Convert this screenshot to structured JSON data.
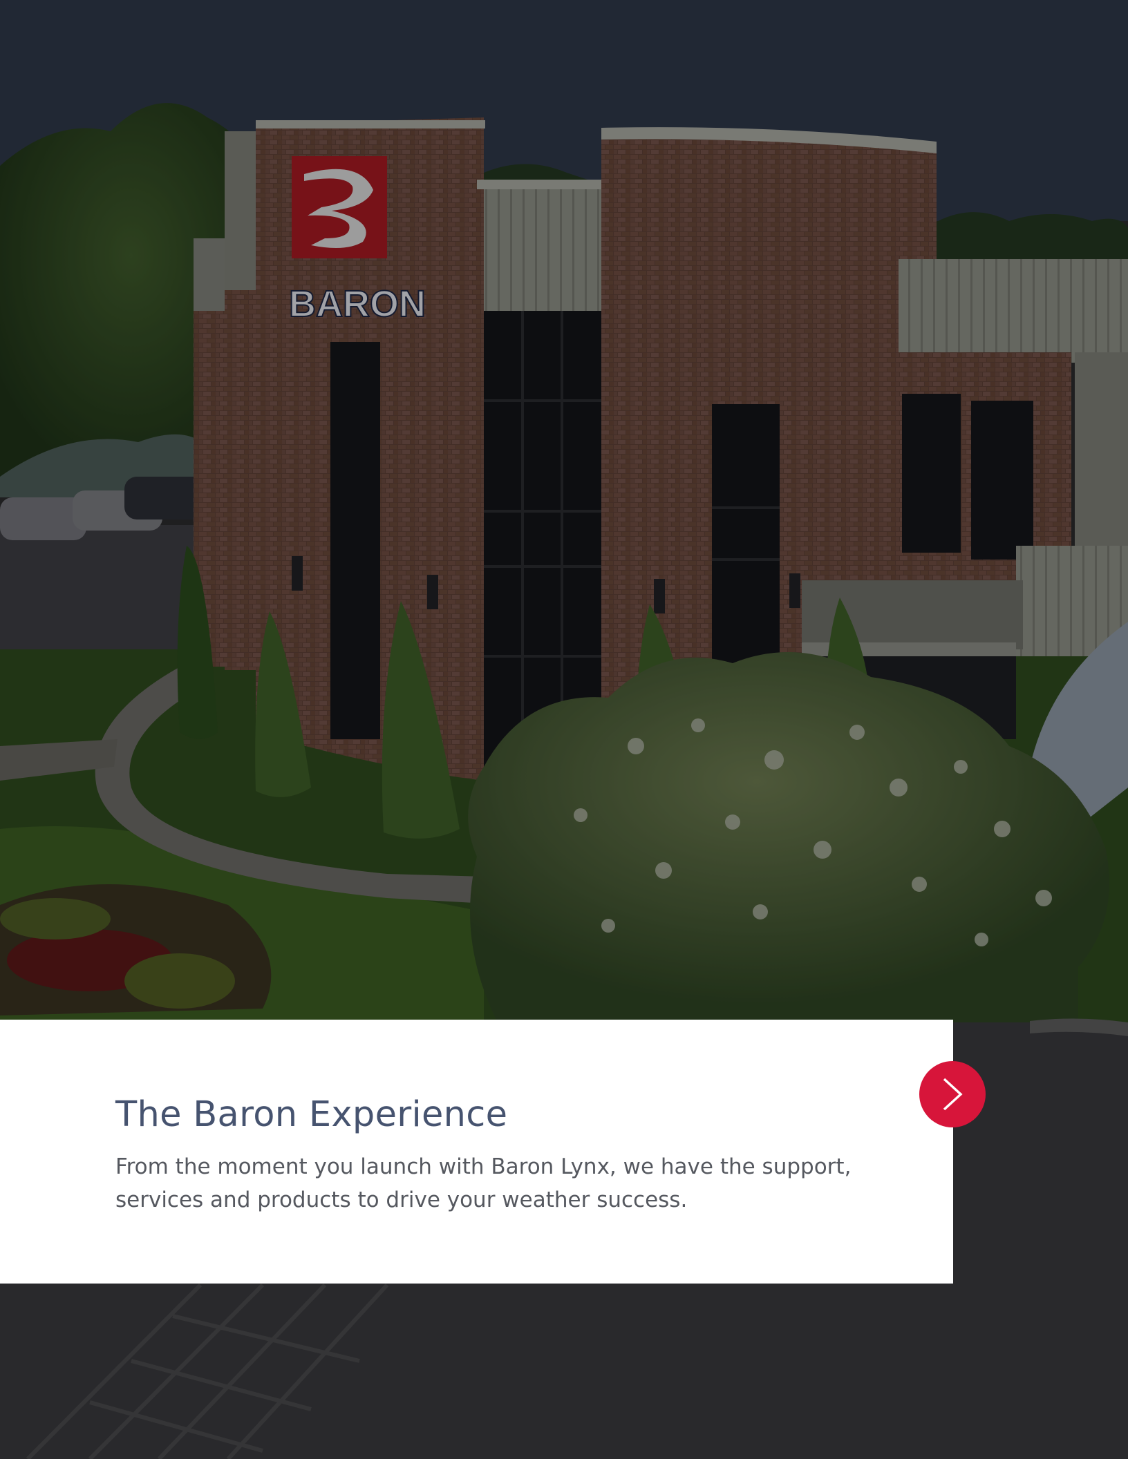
{
  "hero": {
    "sign_text": "BARON"
  },
  "card": {
    "title": "The Baron Experience",
    "body": "From the moment you launch with Baron Lynx, we have the support, services and products to drive your weather success."
  },
  "next_button": {
    "icon": "chevron-right-icon"
  },
  "colors": {
    "brand_red": "#d7153a",
    "title_color": "#46536f",
    "body_color": "#55585f",
    "card_background": "#ffffff"
  }
}
